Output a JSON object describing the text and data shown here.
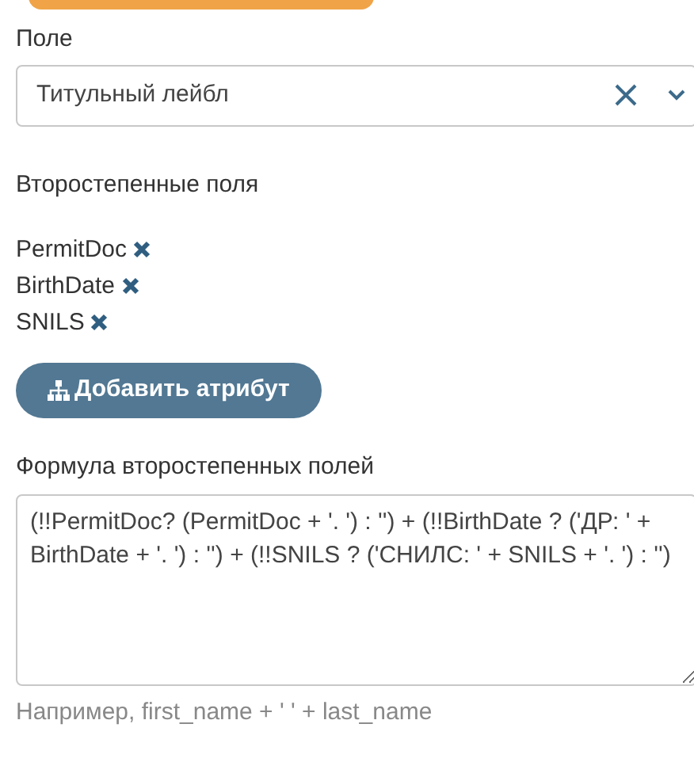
{
  "field": {
    "label": "Поле",
    "value": "Титульный лейбл"
  },
  "secondary": {
    "label": "Второстепенные поля",
    "items": [
      {
        "name": "PermitDoc"
      },
      {
        "name": "BirthDate"
      },
      {
        "name": "SNILS"
      }
    ]
  },
  "add_button": {
    "label": "Добавить атрибут"
  },
  "formula": {
    "label": "Формула второстепенных полей",
    "value": "(!!PermitDoc? (PermitDoc + '. ') : '') + (!!BirthDate ? ('ДР: ' + BirthDate + '. ') : '') + (!!SNILS ? ('СНИЛС: ' + SNILS + '. ') : '')",
    "hint": "Например, first_name + ' ' + last_name"
  }
}
